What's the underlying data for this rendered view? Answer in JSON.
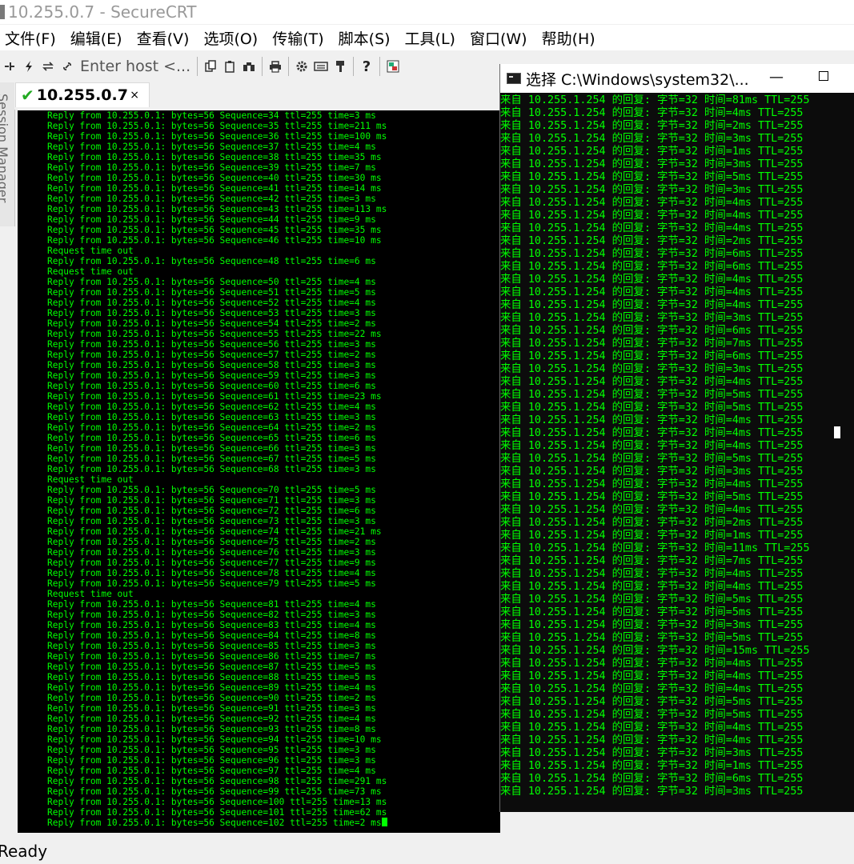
{
  "window": {
    "title": "10.255.0.7 - SecureCRT"
  },
  "menu": [
    "文件(F)",
    "编辑(E)",
    "查看(V)",
    "选项(O)",
    "传输(T)",
    "脚本(S)",
    "工具(L)",
    "窗口(W)",
    "帮助(H)"
  ],
  "toolbar": {
    "host_placeholder": "Enter host <..."
  },
  "sidebar": {
    "label": "Session Manager"
  },
  "tab": {
    "label": "10.255.0.7",
    "close": "×"
  },
  "terminal": {
    "lines": [
      "Reply from 10.255.0.1: bytes=56 Sequence=34 ttl=255 time=3 ms",
      "Reply from 10.255.0.1: bytes=56 Sequence=35 ttl=255 time=211 ms",
      "Reply from 10.255.0.1: bytes=56 Sequence=36 ttl=255 time=100 ms",
      "Reply from 10.255.0.1: bytes=56 Sequence=37 ttl=255 time=4 ms",
      "Reply from 10.255.0.1: bytes=56 Sequence=38 ttl=255 time=35 ms",
      "Reply from 10.255.0.1: bytes=56 Sequence=39 ttl=255 time=7 ms",
      "Reply from 10.255.0.1: bytes=56 Sequence=40 ttl=255 time=30 ms",
      "Reply from 10.255.0.1: bytes=56 Sequence=41 ttl=255 time=14 ms",
      "Reply from 10.255.0.1: bytes=56 Sequence=42 ttl=255 time=3 ms",
      "Reply from 10.255.0.1: bytes=56 Sequence=43 ttl=255 time=113 ms",
      "Reply from 10.255.0.1: bytes=56 Sequence=44 ttl=255 time=9 ms",
      "Reply from 10.255.0.1: bytes=56 Sequence=45 ttl=255 time=35 ms",
      "Reply from 10.255.0.1: bytes=56 Sequence=46 ttl=255 time=10 ms",
      "Request time out",
      "Reply from 10.255.0.1: bytes=56 Sequence=48 ttl=255 time=6 ms",
      "Request time out",
      "Reply from 10.255.0.1: bytes=56 Sequence=50 ttl=255 time=4 ms",
      "Reply from 10.255.0.1: bytes=56 Sequence=51 ttl=255 time=5 ms",
      "Reply from 10.255.0.1: bytes=56 Sequence=52 ttl=255 time=4 ms",
      "Reply from 10.255.0.1: bytes=56 Sequence=53 ttl=255 time=3 ms",
      "Reply from 10.255.0.1: bytes=56 Sequence=54 ttl=255 time=2 ms",
      "Reply from 10.255.0.1: bytes=56 Sequence=55 ttl=255 time=22 ms",
      "Reply from 10.255.0.1: bytes=56 Sequence=56 ttl=255 time=3 ms",
      "Reply from 10.255.0.1: bytes=56 Sequence=57 ttl=255 time=2 ms",
      "Reply from 10.255.0.1: bytes=56 Sequence=58 ttl=255 time=3 ms",
      "Reply from 10.255.0.1: bytes=56 Sequence=59 ttl=255 time=3 ms",
      "Reply from 10.255.0.1: bytes=56 Sequence=60 ttl=255 time=6 ms",
      "Reply from 10.255.0.1: bytes=56 Sequence=61 ttl=255 time=23 ms",
      "Reply from 10.255.0.1: bytes=56 Sequence=62 ttl=255 time=4 ms",
      "Reply from 10.255.0.1: bytes=56 Sequence=63 ttl=255 time=3 ms",
      "Reply from 10.255.0.1: bytes=56 Sequence=64 ttl=255 time=2 ms",
      "Reply from 10.255.0.1: bytes=56 Sequence=65 ttl=255 time=6 ms",
      "Reply from 10.255.0.1: bytes=56 Sequence=66 ttl=255 time=3 ms",
      "Reply from 10.255.0.1: bytes=56 Sequence=67 ttl=255 time=5 ms",
      "Reply from 10.255.0.1: bytes=56 Sequence=68 ttl=255 time=3 ms",
      "Request time out",
      "Reply from 10.255.0.1: bytes=56 Sequence=70 ttl=255 time=5 ms",
      "Reply from 10.255.0.1: bytes=56 Sequence=71 ttl=255 time=3 ms",
      "Reply from 10.255.0.1: bytes=56 Sequence=72 ttl=255 time=6 ms",
      "Reply from 10.255.0.1: bytes=56 Sequence=73 ttl=255 time=3 ms",
      "Reply from 10.255.0.1: bytes=56 Sequence=74 ttl=255 time=21 ms",
      "Reply from 10.255.0.1: bytes=56 Sequence=75 ttl=255 time=2 ms",
      "Reply from 10.255.0.1: bytes=56 Sequence=76 ttl=255 time=3 ms",
      "Reply from 10.255.0.1: bytes=56 Sequence=77 ttl=255 time=9 ms",
      "Reply from 10.255.0.1: bytes=56 Sequence=78 ttl=255 time=4 ms",
      "Reply from 10.255.0.1: bytes=56 Sequence=79 ttl=255 time=5 ms",
      "Request time out",
      "Reply from 10.255.0.1: bytes=56 Sequence=81 ttl=255 time=4 ms",
      "Reply from 10.255.0.1: bytes=56 Sequence=82 ttl=255 time=3 ms",
      "Reply from 10.255.0.1: bytes=56 Sequence=83 ttl=255 time=4 ms",
      "Reply from 10.255.0.1: bytes=56 Sequence=84 ttl=255 time=8 ms",
      "Reply from 10.255.0.1: bytes=56 Sequence=85 ttl=255 time=3 ms",
      "Reply from 10.255.0.1: bytes=56 Sequence=86 ttl=255 time=7 ms",
      "Reply from 10.255.0.1: bytes=56 Sequence=87 ttl=255 time=5 ms",
      "Reply from 10.255.0.1: bytes=56 Sequence=88 ttl=255 time=5 ms",
      "Reply from 10.255.0.1: bytes=56 Sequence=89 ttl=255 time=4 ms",
      "Reply from 10.255.0.1: bytes=56 Sequence=90 ttl=255 time=2 ms",
      "Reply from 10.255.0.1: bytes=56 Sequence=91 ttl=255 time=3 ms",
      "Reply from 10.255.0.1: bytes=56 Sequence=92 ttl=255 time=4 ms",
      "Reply from 10.255.0.1: bytes=56 Sequence=93 ttl=255 time=8 ms",
      "Reply from 10.255.0.1: bytes=56 Sequence=94 ttl=255 time=10 ms",
      "Reply from 10.255.0.1: bytes=56 Sequence=95 ttl=255 time=3 ms",
      "Reply from 10.255.0.1: bytes=56 Sequence=96 ttl=255 time=3 ms",
      "Reply from 10.255.0.1: bytes=56 Sequence=97 ttl=255 time=4 ms",
      "Reply from 10.255.0.1: bytes=56 Sequence=98 ttl=255 time=291 ms",
      "Reply from 10.255.0.1: bytes=56 Sequence=99 ttl=255 time=73 ms",
      "Reply from 10.255.0.1: bytes=56 Sequence=100 ttl=255 time=13 ms",
      "Reply from 10.255.0.1: bytes=56 Sequence=101 ttl=255 time=62 ms",
      "Reply from 10.255.0.1: bytes=56 Sequence=102 ttl=255 time=2 ms"
    ]
  },
  "cmd": {
    "title": "选择 C:\\Windows\\system32\\...",
    "minimize": "—",
    "lines": [
      "来自 10.255.1.254 的回复: 字节=32 时间=81ms TTL=255",
      "来自 10.255.1.254 的回复: 字节=32 时间=4ms TTL=255",
      "来自 10.255.1.254 的回复: 字节=32 时间=2ms TTL=255",
      "来自 10.255.1.254 的回复: 字节=32 时间=3ms TTL=255",
      "来自 10.255.1.254 的回复: 字节=32 时间=1ms TTL=255",
      "来自 10.255.1.254 的回复: 字节=32 时间=3ms TTL=255",
      "来自 10.255.1.254 的回复: 字节=32 时间=5ms TTL=255",
      "来自 10.255.1.254 的回复: 字节=32 时间=3ms TTL=255",
      "来自 10.255.1.254 的回复: 字节=32 时间=4ms TTL=255",
      "来自 10.255.1.254 的回复: 字节=32 时间=4ms TTL=255",
      "来自 10.255.1.254 的回复: 字节=32 时间=4ms TTL=255",
      "来自 10.255.1.254 的回复: 字节=32 时间=2ms TTL=255",
      "来自 10.255.1.254 的回复: 字节=32 时间=6ms TTL=255",
      "来自 10.255.1.254 的回复: 字节=32 时间=6ms TTL=255",
      "来自 10.255.1.254 的回复: 字节=32 时间=4ms TTL=255",
      "来自 10.255.1.254 的回复: 字节=32 时间=4ms TTL=255",
      "来自 10.255.1.254 的回复: 字节=32 时间=4ms TTL=255",
      "来自 10.255.1.254 的回复: 字节=32 时间=3ms TTL=255",
      "来自 10.255.1.254 的回复: 字节=32 时间=6ms TTL=255",
      "来自 10.255.1.254 的回复: 字节=32 时间=7ms TTL=255",
      "来自 10.255.1.254 的回复: 字节=32 时间=6ms TTL=255",
      "来自 10.255.1.254 的回复: 字节=32 时间=3ms TTL=255",
      "来自 10.255.1.254 的回复: 字节=32 时间=4ms TTL=255",
      "来自 10.255.1.254 的回复: 字节=32 时间=5ms TTL=255",
      "来自 10.255.1.254 的回复: 字节=32 时间=5ms TTL=255",
      "来自 10.255.1.254 的回复: 字节=32 时间=4ms TTL=255",
      "来自 10.255.1.254 的回复: 字节=32 时间=4ms TTL=255",
      "来自 10.255.1.254 的回复: 字节=32 时间=4ms TTL=255",
      "来自 10.255.1.254 的回复: 字节=32 时间=5ms TTL=255",
      "来自 10.255.1.254 的回复: 字节=32 时间=3ms TTL=255",
      "来自 10.255.1.254 的回复: 字节=32 时间=4ms TTL=255",
      "来自 10.255.1.254 的回复: 字节=32 时间=5ms TTL=255",
      "来自 10.255.1.254 的回复: 字节=32 时间=4ms TTL=255",
      "来自 10.255.1.254 的回复: 字节=32 时间=2ms TTL=255",
      "来自 10.255.1.254 的回复: 字节=32 时间=1ms TTL=255",
      "来自 10.255.1.254 的回复: 字节=32 时间=11ms TTL=255",
      "来自 10.255.1.254 的回复: 字节=32 时间=7ms TTL=255",
      "来自 10.255.1.254 的回复: 字节=32 时间=4ms TTL=255",
      "来自 10.255.1.254 的回复: 字节=32 时间=4ms TTL=255",
      "来自 10.255.1.254 的回复: 字节=32 时间=5ms TTL=255",
      "来自 10.255.1.254 的回复: 字节=32 时间=5ms TTL=255",
      "来自 10.255.1.254 的回复: 字节=32 时间=3ms TTL=255",
      "来自 10.255.1.254 的回复: 字节=32 时间=5ms TTL=255",
      "来自 10.255.1.254 的回复: 字节=32 时间=15ms TTL=255",
      "来自 10.255.1.254 的回复: 字节=32 时间=4ms TTL=255",
      "来自 10.255.1.254 的回复: 字节=32 时间=4ms TTL=255",
      "来自 10.255.1.254 的回复: 字节=32 时间=4ms TTL=255",
      "来自 10.255.1.254 的回复: 字节=32 时间=5ms TTL=255",
      "来自 10.255.1.254 的回复: 字节=32 时间=5ms TTL=255",
      "来自 10.255.1.254 的回复: 字节=32 时间=4ms TTL=255",
      "来自 10.255.1.254 的回复: 字节=32 时间=4ms TTL=255",
      "来自 10.255.1.254 的回复: 字节=32 时间=3ms TTL=255",
      "来自 10.255.1.254 的回复: 字节=32 时间=1ms TTL=255",
      "来自 10.255.1.254 的回复: 字节=32 时间=6ms TTL=255",
      "来自 10.255.1.254 的回复: 字节=32 时间=3ms TTL=255"
    ]
  },
  "status": {
    "text": "Ready"
  },
  "colors": {
    "terminal_fg": "#00ff00",
    "terminal_bg": "#000000",
    "check": "#22aa22"
  }
}
